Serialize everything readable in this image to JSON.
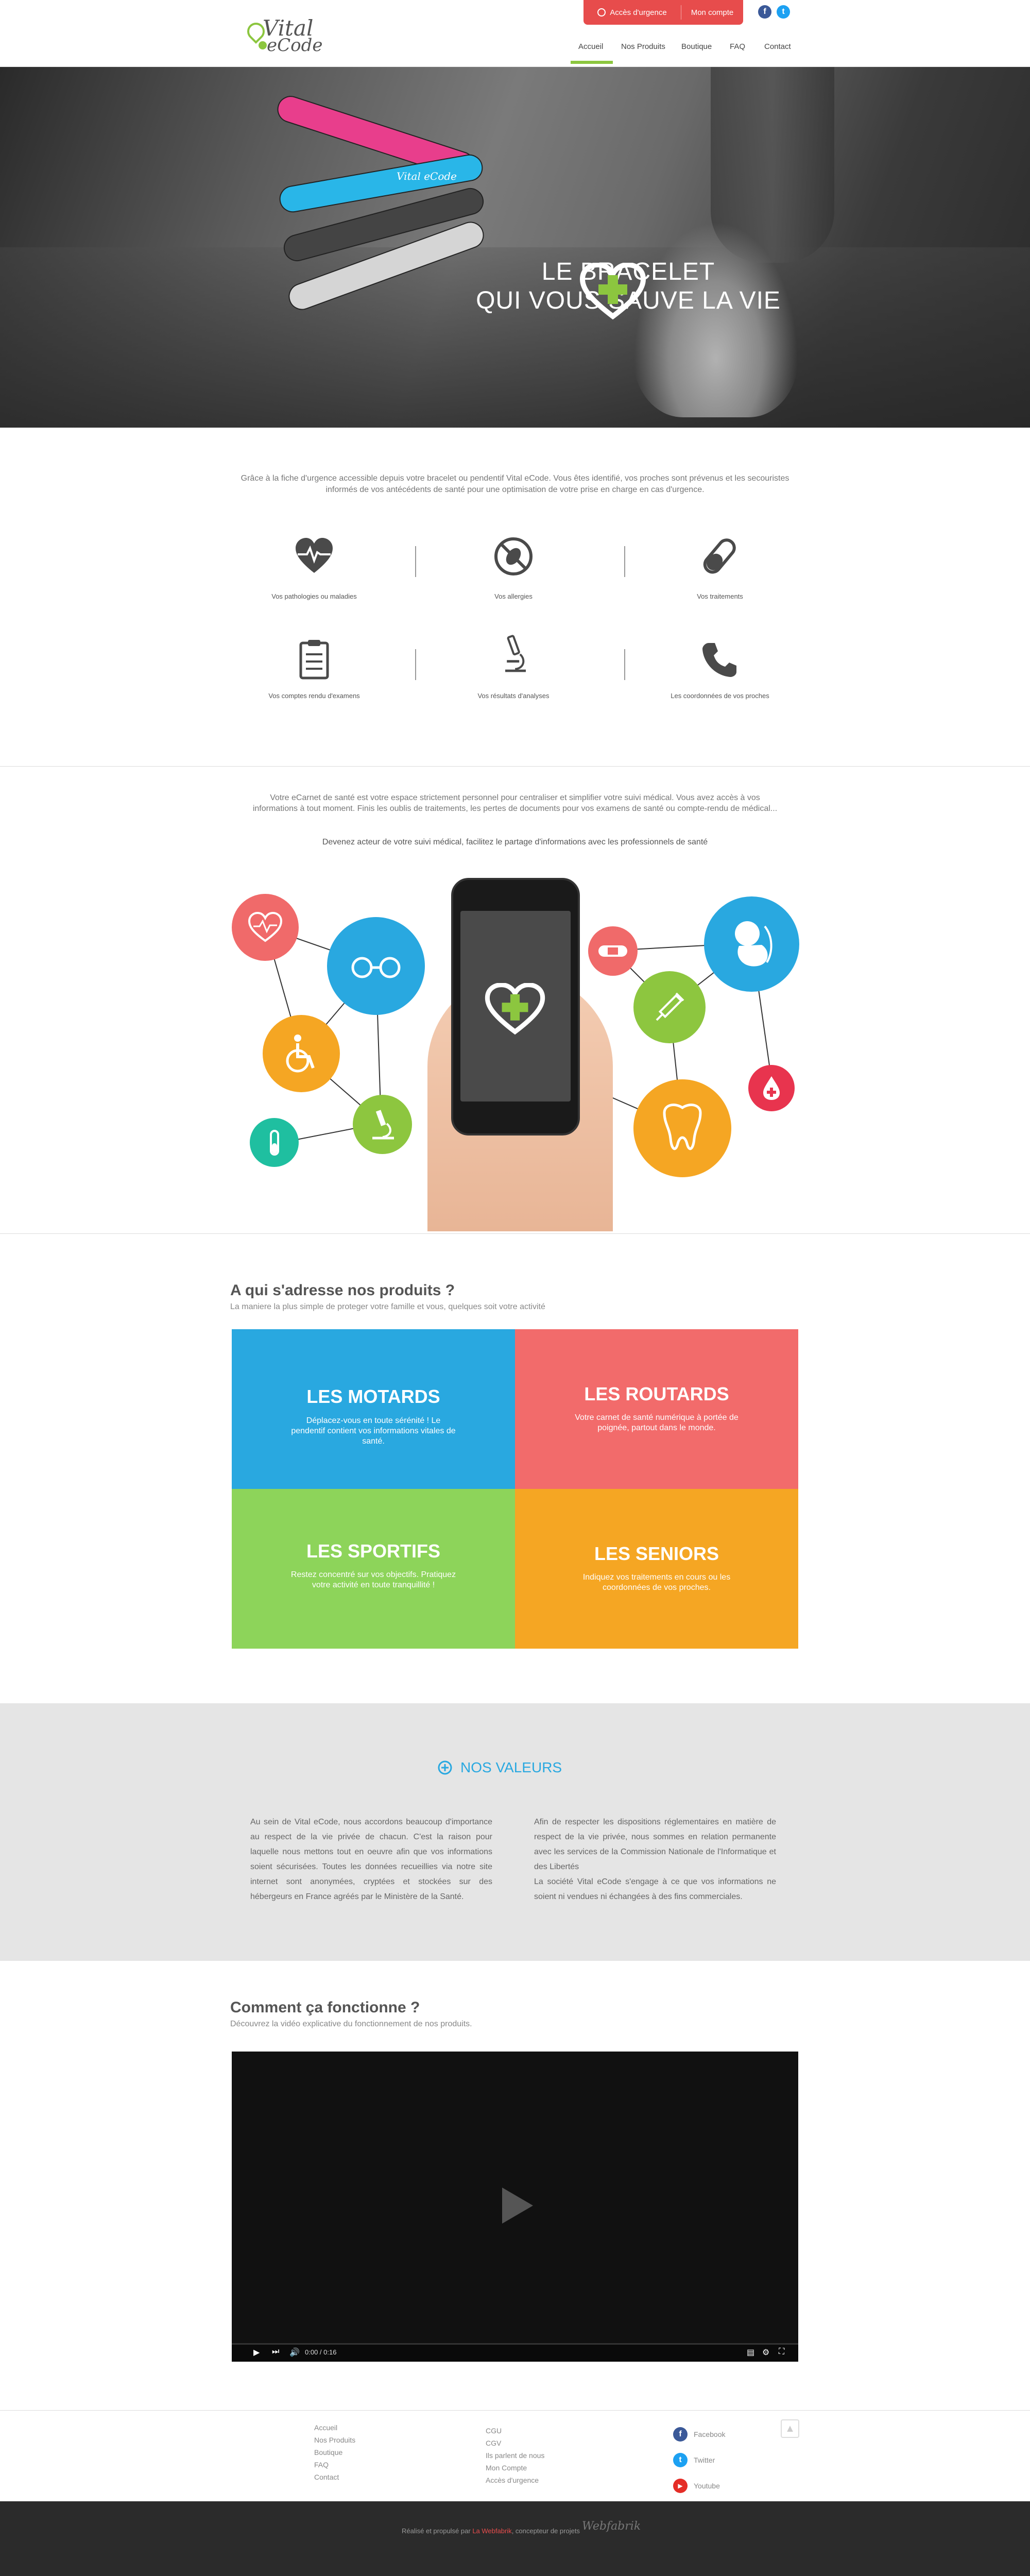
{
  "header": {
    "logo_line1": "Vital",
    "logo_line2": "eCode",
    "urgence_label": "Accès d'urgence",
    "compte_label": "Mon compte",
    "nav": [
      "Accueil",
      "Nos Produits",
      "Boutique",
      "FAQ",
      "Contact"
    ],
    "facebook_glyph": "f",
    "twitter_glyph": "t",
    "colors": {
      "accent": "#8cc63f",
      "urgent": "#e74c4c"
    }
  },
  "hero": {
    "title_line1": "LE BRACELET",
    "title_line2": "QUI VOUS SAUVE LA VIE",
    "band_text": "Vital eCode"
  },
  "intro": {
    "text": "Grâce à la fiche d'urgence accessible depuis votre bracelet ou pendentif Vital eCode. Vous êtes identifié, vos proches sont prévenus et les secouristes informés de vos antécédents de santé pour une optimisation de votre prise en charge en cas d'urgence."
  },
  "features": [
    {
      "icon": "heart-pulse-icon",
      "label": "Vos pathologies ou maladies"
    },
    {
      "icon": "no-allergy-icon",
      "label": "Vos allergies"
    },
    {
      "icon": "pill-icon",
      "label": "Vos traitements"
    },
    {
      "icon": "clipboard-icon",
      "label": "Vos comptes rendu d'examens"
    },
    {
      "icon": "microscope-icon",
      "label": "Vos résultats d'analyses"
    },
    {
      "icon": "phone-icon",
      "label": "Les coordonnées de vos proches"
    }
  ],
  "ecarnet": {
    "text": "Votre eCarnet de santé est votre espace strictement personnel pour centraliser et simplifier votre suivi médical. Vous avez accès à vos informations à tout moment. Finis les oublis de traitements, les pertes de documents pour vos examens de santé ou compte-rendu de médical...",
    "strong": "Devenez acteur de votre suivi médical, facilitez le partage d'informations avec les professionnels de santé"
  },
  "audience": {
    "title": "A qui s'adresse nos produits ?",
    "subtitle": "La maniere la plus simple de proteger votre famille et vous, quelques soit votre activité",
    "tiles": [
      {
        "title": "LES MOTARDS",
        "desc": "Déplacez-vous en toute sérénité ! Le pendentif contient vos informations vitales de santé.",
        "color": "#29a8e0"
      },
      {
        "title": "LES ROUTARDS",
        "desc": "Votre carnet de santé numérique à portée de poignée, partout dans le monde.",
        "color": "#f26b6b"
      },
      {
        "title": "LES SPORTIFS",
        "desc": "Restez concentré sur vos objectifs. Pratiquez votre activité en toute tranquillité !",
        "color": "#8dd45a"
      },
      {
        "title": "LES SENIORS",
        "desc": "Indiquez vos traitements en cours ou les coordonnées de vos proches.",
        "color": "#f5a623"
      }
    ]
  },
  "values": {
    "title": "NOS VALEURS",
    "col1": "Au sein de Vital eCode, nous accordons beaucoup d'importance au respect de la vie privée de chacun. C'est la raison pour laquelle nous mettons tout en oeuvre afin que vos informations soient sécurisées. Toutes les données recueillies via notre site internet sont anonymées, cryptées et stockées sur des hébergeurs en France agréés par le Ministère de la Santé.",
    "col2a": "Afin de respecter les dispositions réglementaires en matière de respect de la vie privée, nous sommes en relation permanente avec les services de la Commission Nationale de l'Informatique et des Libertés",
    "col2b": "La société Vital eCode s'engage à ce que vos informations ne soient ni vendues ni échangées à des fins commerciales."
  },
  "video": {
    "title": "Comment ça fonctionne ?",
    "subtitle": "Découvrez la vidéo explicative du fonctionnement de nos produits.",
    "time": "0:00 / 0:16"
  },
  "footer": {
    "col1": [
      "Accueil",
      "Nos Produits",
      "Boutique",
      "FAQ",
      "Contact"
    ],
    "col2": [
      "CGU",
      "CGV",
      "Ils parlent de nous",
      "Mon Compte",
      "Accès d'urgence"
    ],
    "social": [
      "Facebook",
      "Twitter",
      "Youtube"
    ],
    "credits_prefix": "Réalisé et propulsé par",
    "credits_link": "La Webfabrik",
    "credits_suffix": ", concepteur de projets",
    "signature": "Webfabrik"
  }
}
